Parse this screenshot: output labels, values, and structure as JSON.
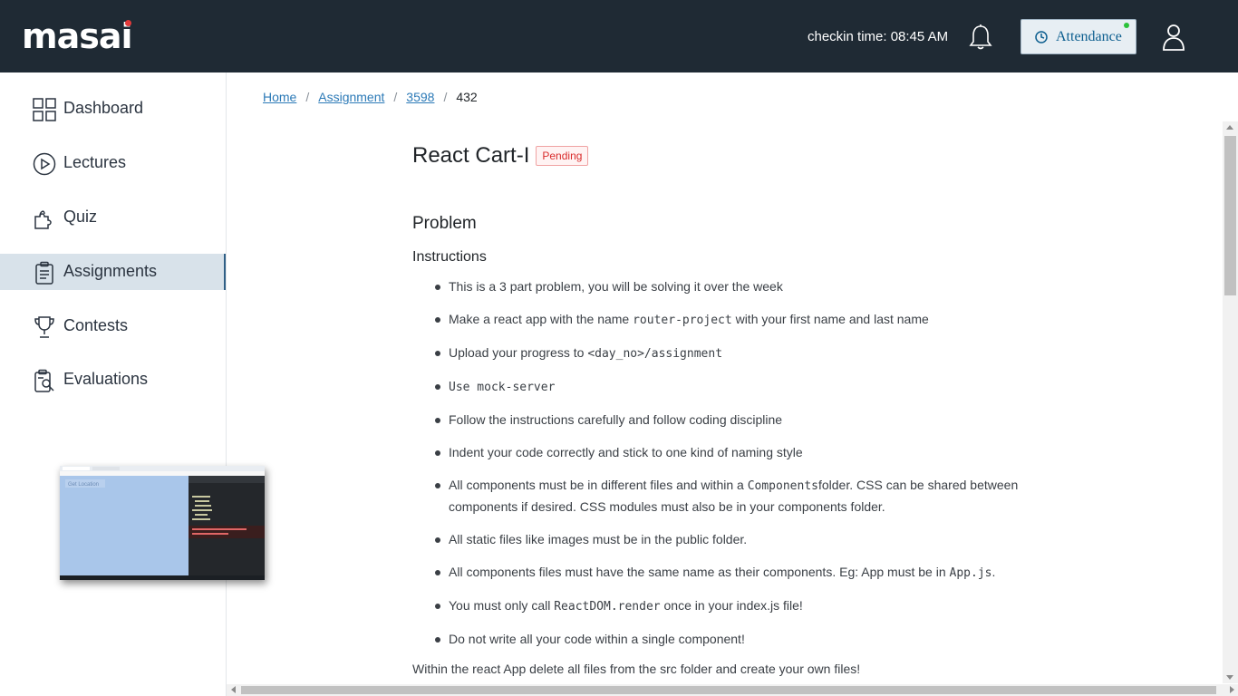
{
  "header": {
    "logo": "masai",
    "checkin": "checkin time: 08:45 AM",
    "attendance_label": "Attendance",
    "icons": [
      "bell-icon",
      "attendance-icon",
      "user-icon"
    ]
  },
  "sidebar": {
    "items": [
      {
        "label": "Dashboard",
        "icon": "grid-icon"
      },
      {
        "label": "Lectures",
        "icon": "play-circle-icon"
      },
      {
        "label": "Quiz",
        "icon": "puzzle-icon"
      },
      {
        "label": "Assignments",
        "icon": "clipboard-icon",
        "active": true
      },
      {
        "label": "Contests",
        "icon": "trophy-icon"
      },
      {
        "label": "Evaluations",
        "icon": "evaluation-icon"
      }
    ]
  },
  "thumbnail": {
    "button_label": "Get Location"
  },
  "breadcrumb": {
    "home": "Home",
    "assignment": "Assignment",
    "id": "3598",
    "current": "432",
    "separator": "/"
  },
  "assignment": {
    "title": "React Cart-I",
    "status": "Pending",
    "problem_heading": "Problem",
    "instructions_heading": "Instructions",
    "items": {
      "i1": "This is a 3 part problem, you will be solving it over the week",
      "i2a": "Make a react app with the name ",
      "i2b": "router-project",
      "i2c": " with your first name and last name",
      "i3a": "Upload your progress to ",
      "i3b": "<day_no>/assignment",
      "i4": "Use mock-server",
      "i5": "Follow the instructions carefully and follow coding discipline",
      "i6": "Indent your code correctly and stick to one kind of naming style",
      "i7a": "All components must be in different files and within a ",
      "i7b": "Components",
      "i7c": "folder. CSS can be shared between components if desired. CSS modules must also be in your components folder.",
      "i8": "All static files like images must be in the public folder.",
      "i9a": "All components files must have the same name as their components. Eg: App must be in ",
      "i9b": "App.js",
      "i9c": ".",
      "i10a": "You must only call ",
      "i10b": "ReactDOM.render",
      "i10c": " once in your index.js file!",
      "i11": "Do not write all your code within a single component!"
    },
    "footer": "Within the react App delete all files from the src folder and create your own files!"
  },
  "colors": {
    "topbar": "#1f2a34",
    "active_item": "#d8e2ea",
    "link": "#2c7ab7",
    "pending": "#d92c2c"
  }
}
